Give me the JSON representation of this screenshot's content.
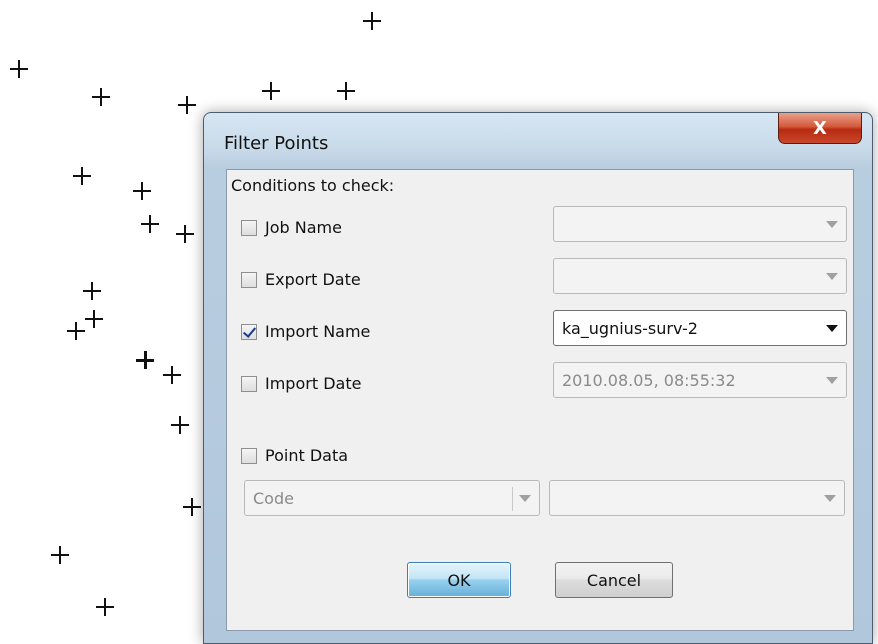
{
  "window": {
    "title": "Filter Points",
    "close_label": "X"
  },
  "group": {
    "label": "Conditions to check:"
  },
  "conditions": [
    {
      "label": "Job Name",
      "checked": false,
      "combo_value": "",
      "enabled": false
    },
    {
      "label": "Export Date",
      "checked": false,
      "combo_value": "",
      "enabled": false
    },
    {
      "label": "Import Name",
      "checked": true,
      "combo_value": "ka_ugnius-surv-2",
      "enabled": true
    },
    {
      "label": "Import Date",
      "checked": false,
      "combo_value": "2010.08.05, 08:55:32",
      "enabled": false
    }
  ],
  "point_data": {
    "label": "Point Data",
    "checked": false,
    "field_value": "Code",
    "value_value": ""
  },
  "buttons": {
    "ok": "OK",
    "cancel": "Cancel"
  },
  "icons": {
    "checkmark": "check-icon",
    "dropdown": "chevron-down-icon"
  }
}
